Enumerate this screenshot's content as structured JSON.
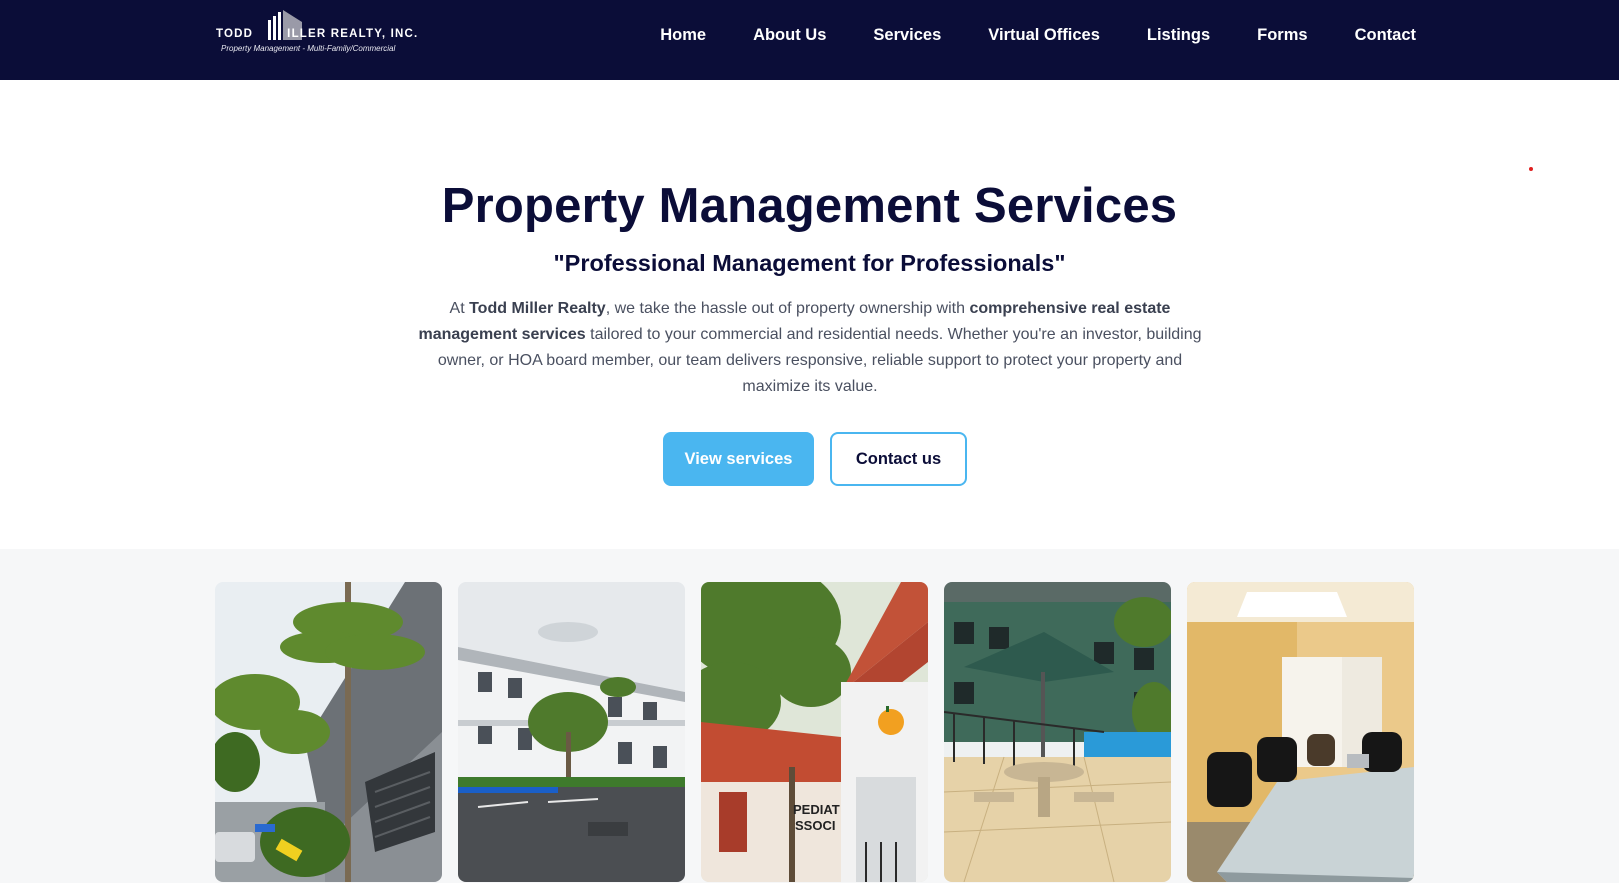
{
  "header": {
    "logo": {
      "name_part1": "TODD",
      "name_part2": "ILLER REALTY, INC.",
      "tagline": "Property Management - Multi-Family/Commercial"
    },
    "nav": [
      {
        "label": "Home"
      },
      {
        "label": "About Us"
      },
      {
        "label": "Services"
      },
      {
        "label": "Virtual Offices"
      },
      {
        "label": "Listings"
      },
      {
        "label": "Forms"
      },
      {
        "label": "Contact"
      }
    ]
  },
  "hero": {
    "title": "Property Management Services",
    "subtitle": "\"Professional Management for Professionals\"",
    "intro": {
      "t1": "At ",
      "b1": "Todd Miller Realty",
      "t2": ", we take the hassle out of property ownership with ",
      "b2": "comprehensive real estate management services",
      "t3": " tailored to your commercial and residential needs. Whether you're an investor, building owner, or HOA board member, our team delivers responsive, reliable support to protect your property and maximize its value."
    },
    "buttons": {
      "primary": "View services",
      "secondary": "Contact us"
    }
  },
  "gallery": {
    "photos": [
      {
        "subject": "building-with-palm-trees"
      },
      {
        "subject": "two-story-office-parking-lot"
      },
      {
        "subject": "red-tile-roof-pediatric-building",
        "sign_text": "PEDIAT ASSOCI"
      },
      {
        "subject": "courtyard-pool-umbrella"
      },
      {
        "subject": "conference-room"
      }
    ]
  },
  "colors": {
    "navy": "#0b0d38",
    "accent_blue": "#4ab6f0",
    "body_text": "#4a5060",
    "gallery_bg": "#f6f7f8"
  }
}
